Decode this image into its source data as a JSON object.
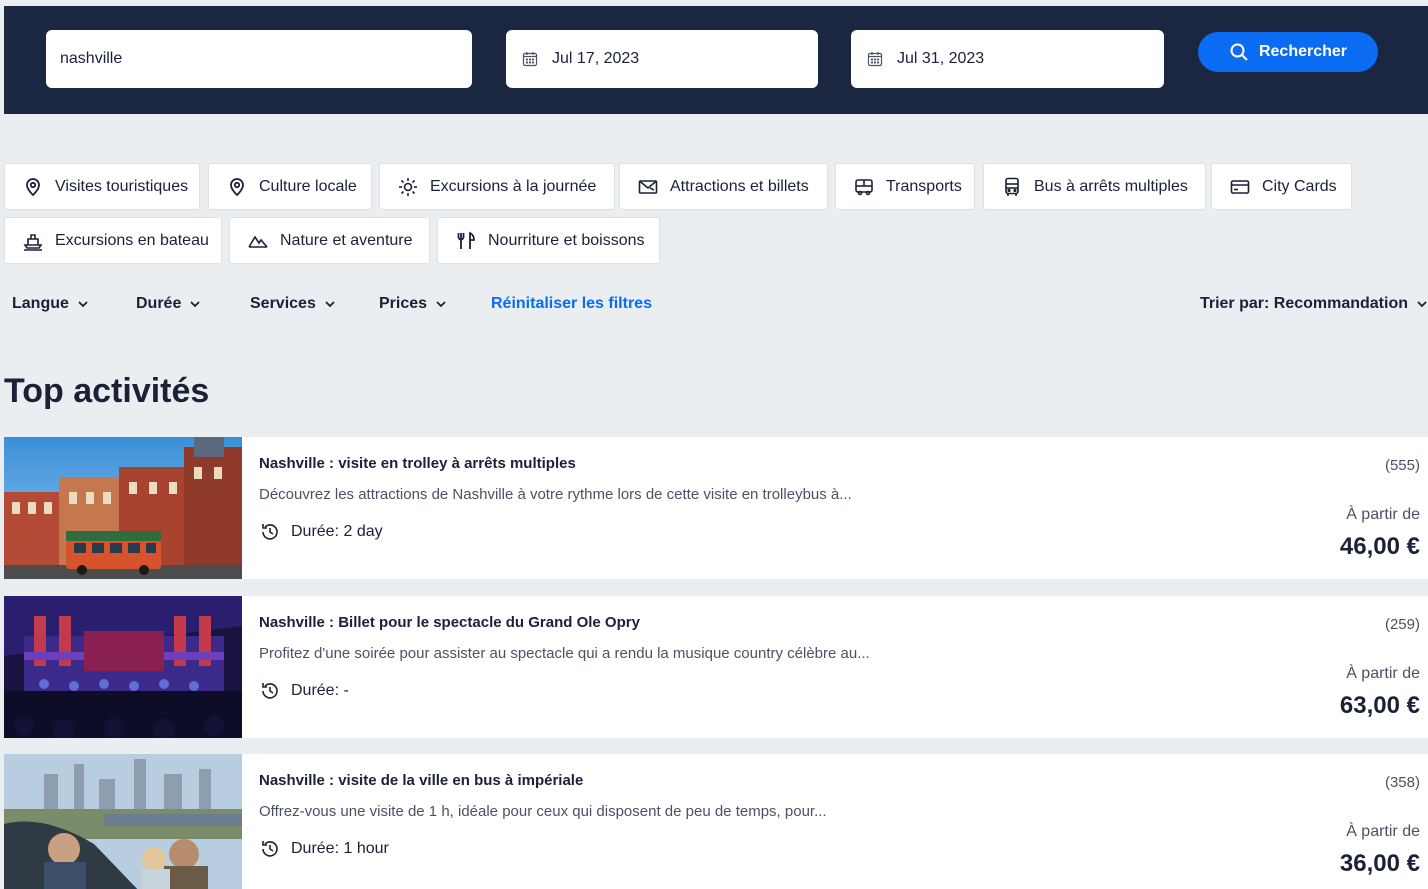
{
  "search": {
    "query": "nashville",
    "date_start": "Jul 17, 2023",
    "date_end": "Jul 31, 2023",
    "button_label": "Rechercher"
  },
  "categories": [
    {
      "label": "Visites touristiques",
      "icon": "location-pin-icon"
    },
    {
      "label": "Culture locale",
      "icon": "location-pin-icon"
    },
    {
      "label": "Excursions à la journée",
      "icon": "sun-icon"
    },
    {
      "label": "Attractions et billets",
      "icon": "ticket-icon"
    },
    {
      "label": "Transports",
      "icon": "bus-icon"
    },
    {
      "label": "Bus à arrêts multiples",
      "icon": "bus-front-icon"
    },
    {
      "label": "City Cards",
      "icon": "card-icon"
    },
    {
      "label": "Excursions en bateau",
      "icon": "boat-icon"
    },
    {
      "label": "Nature et aventure",
      "icon": "mountain-icon"
    },
    {
      "label": "Nourriture et boissons",
      "icon": "fork-knife-icon"
    }
  ],
  "filters": {
    "language": "Langue",
    "duration": "Durée",
    "services": "Services",
    "prices": "Prices",
    "reset": "Réinitaliser les filtres",
    "sort": "Trier par: Recommandation"
  },
  "section_title": "Top activités",
  "activities": [
    {
      "title": "Nashville : visite en trolley à arrêts multiples",
      "description": "Découvrez les attractions de Nashville à votre rythme lors de cette visite en trolleybus à...",
      "duration": "Durée: 2 day",
      "reviews": "(555)",
      "from_label": "À partir de",
      "price": "46,00 €"
    },
    {
      "title": "Nashville : Billet pour le spectacle du Grand Ole Opry",
      "description": "Profitez d'une soirée pour assister au spectacle qui a rendu la musique country célèbre au...",
      "duration": "Durée: -",
      "reviews": "(259)",
      "from_label": "À partir de",
      "price": "63,00 €"
    },
    {
      "title": "Nashville : visite de la ville en bus à impériale",
      "description": "Offrez-vous une visite de 1 h, idéale pour ceux qui disposent de peu de temps, pour...",
      "duration": "Durée: 1 hour",
      "reviews": "(358)",
      "from_label": "À partir de",
      "price": "36,00 €"
    }
  ]
}
